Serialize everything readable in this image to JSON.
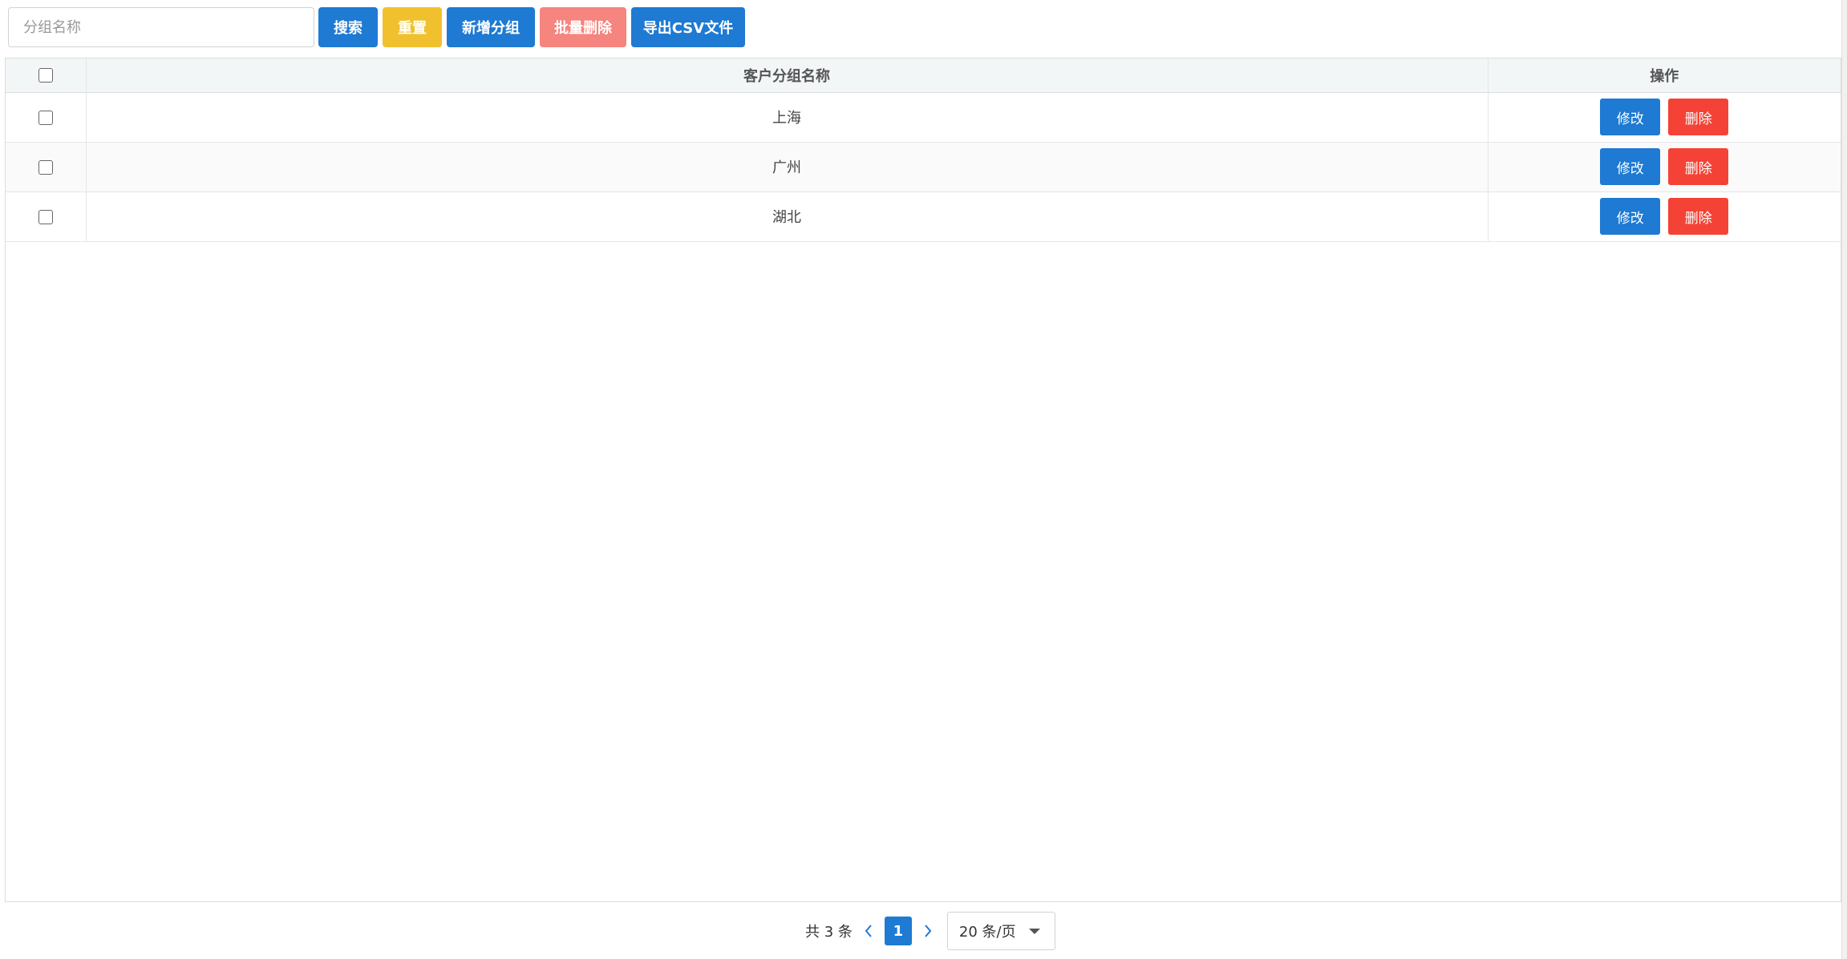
{
  "toolbar": {
    "search_placeholder": "分组名称",
    "search_value": "",
    "buttons": {
      "search": "搜索",
      "reset": "重置",
      "add_group": "新增分组",
      "batch_delete": "批量删除",
      "export_csv": "导出CSV文件"
    }
  },
  "table": {
    "headers": {
      "name": "客户分组名称",
      "ops": "操作"
    },
    "rows": [
      {
        "name": "上海",
        "edit": "修改",
        "delete": "删除"
      },
      {
        "name": "广州",
        "edit": "修改",
        "delete": "删除"
      },
      {
        "name": "湖北",
        "edit": "修改",
        "delete": "删除"
      }
    ]
  },
  "pagination": {
    "total_text": "共 3 条",
    "current_page": "1",
    "page_size": "20 条/页"
  },
  "colors": {
    "primary": "#1e7ad2",
    "warning": "#f0c02e",
    "danger": "#f44336",
    "danger_light": "#f6847f"
  }
}
